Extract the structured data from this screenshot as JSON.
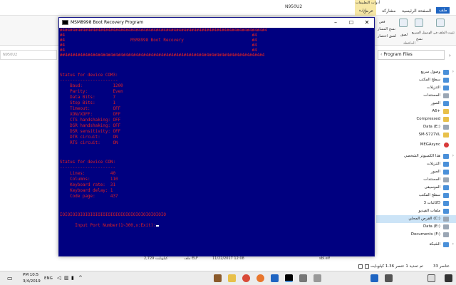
{
  "explorer": {
    "tabs": [
      {
        "label": "ملف"
      },
      {
        "label": "الصفحة الرئيسية"
      },
      {
        "label": "مشاركة"
      },
      {
        "label": "عرض"
      },
      {
        "label": "إدارة"
      }
    ],
    "context_tab": "أدوات التطبيقات",
    "context_title": "N950U2",
    "ribbon_buttons": [
      {
        "label": "تثبيت الملف في الوصول السريع"
      },
      {
        "label": "نسخ"
      },
      {
        "label": "لصق"
      },
      {
        "label": "قص"
      },
      {
        "label": "نسخ المسار"
      },
      {
        "label": "لصق اختصار"
      },
      {
        "label": "الحافظة"
      }
    ],
    "address_path": "Program Files",
    "address_left": "N950U2",
    "nav_items": [
      {
        "label": "وصول سريع",
        "icon": "star-icon"
      },
      {
        "label": "سطح المكتب",
        "icon": "desktop-icon"
      },
      {
        "label": "التنزيلات",
        "icon": "download-icon"
      },
      {
        "label": "المستندات",
        "icon": "documents-icon"
      },
      {
        "label": "الصور",
        "icon": "pictures-icon"
      },
      {
        "label": "A6+",
        "icon": "folder-icon"
      },
      {
        "label": "Compressed",
        "icon": "folder-icon"
      },
      {
        "label": "Data (E:)",
        "icon": "drive-icon"
      },
      {
        "label": "SM-S727VL",
        "icon": "folder-icon"
      },
      {
        "label": "MEGAsync",
        "icon": "mega-icon"
      },
      {
        "label": "هذا الكمبيوتر الشخصي",
        "icon": "pc-icon"
      },
      {
        "label": "التنزيلات",
        "icon": "download-icon"
      },
      {
        "label": "الصور",
        "icon": "pictures-icon"
      },
      {
        "label": "المستندات",
        "icon": "documents-icon"
      },
      {
        "label": "الموسيقى",
        "icon": "music-icon"
      },
      {
        "label": "سطح المكتب",
        "icon": "desktop-icon"
      },
      {
        "label": "كائنات 3D",
        "icon": "objects3d-icon"
      },
      {
        "label": "ملفات الفيديو",
        "icon": "video-icon"
      },
      {
        "label": "القرص المحلي (C:)",
        "icon": "drive-icon"
      },
      {
        "label": "Data (E:)",
        "icon": "drive-icon"
      },
      {
        "label": "Documents (F:)",
        "icon": "drive-icon"
      },
      {
        "label": "الشبكة",
        "icon": "network-icon"
      }
    ],
    "file_row": {
      "name": "sbl.elf",
      "date": "11/22/2017 12:08",
      "type": "ملف ELF",
      "size": "2,729 كيلوبايت"
    },
    "status_left": "33 عناصر",
    "status_right": "تم تحديد 1 عنصر 1.36 كيلوبايت"
  },
  "console": {
    "title": "MSM8998 Boot Recovery Program",
    "lines": [
      "#4#4#4#4#4#4#4#4#4#4#4#4#4#4#4#4#4#4#4#4#4#4#4#4#4#4#4#4#4#4#4#4#4#4#4#4#4#4#4#4#4",
      "#4                                                                          #4",
      "#4                          MSM8998 Boot Recovery                           #4",
      "#4                                                                          #4",
      "#4                                                                          #4",
      "##4#4#4#4#4#4#4#4#4#4#4#4#4#4#4#4#4#4#4#4#4#4#4#4#4#4#4#4#4#4#4#4#4#4#4#4#4#4#4#4",
      "",
      "",
      "Status for device COM3:",
      "-----------------------",
      "    Baud:            1200",
      "    Parity:          Even",
      "    Data Bits:       7",
      "    Stop Bits:       1",
      "    Timeout:         OFF",
      "    XON/XOFF:        OFF",
      "    CTS handshaking: OFF",
      "    DSR handshaking: OFF",
      "    DSR sensitivity: OFF",
      "    DTR circuit:     ON",
      "    RTS circuit:     ON",
      "",
      "",
      "Status for device CON:",
      "----------------------",
      "    Lines:          40",
      "    Columns:        110",
      "    Keyboard rate:  31",
      "    Keyboard delay: 1",
      "    Code page:      437",
      "",
      "",
      "IOIOIOIOIOIOIOIOIOIOIOIOIOIOIOIOIOIOIOIOIO",
      "Input Port Number(1~300,x:Exit):"
    ]
  },
  "taskbar": {
    "lang": "ENG",
    "time": "PM 10:5",
    "date": "3/4/2019"
  },
  "colors": {
    "console_bg": "#000080",
    "console_text": "#e02020",
    "ribbon_accent": "#1f65c2"
  }
}
